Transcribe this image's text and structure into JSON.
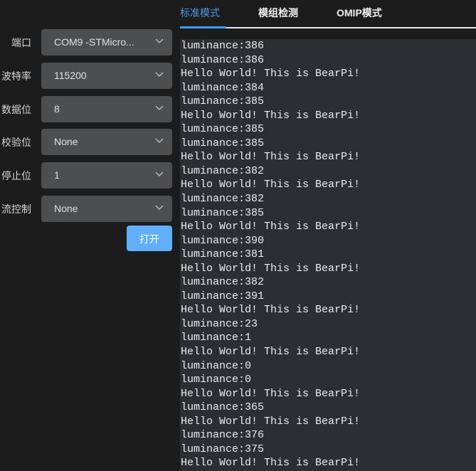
{
  "settings": {
    "fields": [
      {
        "label": "端口",
        "value": "COM9 -STMicro..."
      },
      {
        "label": "波特率",
        "value": "115200"
      },
      {
        "label": "数据位",
        "value": "8"
      },
      {
        "label": "校验位",
        "value": "None"
      },
      {
        "label": "停止位",
        "value": "1"
      },
      {
        "label": "流控制",
        "value": "None"
      }
    ],
    "open_button": "打开"
  },
  "tabs": [
    {
      "label": "标准模式",
      "active": true
    },
    {
      "label": "模组检测",
      "active": false
    },
    {
      "label": "OMIP模式",
      "active": false
    }
  ],
  "colors": {
    "accent": "#409eff",
    "button": "#61aefb",
    "console_bg": "#2b2f31"
  },
  "console": {
    "lines": [
      "luminance:386",
      "luminance:386",
      "Hello World! This is BearPi!",
      "luminance:384",
      "luminance:385",
      "Hello World! This is BearPi!",
      "luminance:385",
      "luminance:385",
      "Hello World! This is BearPi!",
      "luminance:382",
      "Hello World! This is BearPi!",
      "luminance:382",
      "luminance:385",
      "Hello World! This is BearPi!",
      "luminance:390",
      "luminance:381",
      "Hello World! This is BearPi!",
      "luminance:382",
      "luminance:391",
      "Hello World! This is BearPi!",
      "luminance:23",
      "luminance:1",
      "Hello World! This is BearPi!",
      "luminance:0",
      "luminance:0",
      "Hello World! This is BearPi!",
      "luminance:365",
      "Hello World! This is BearPi!",
      "luminance:376",
      "luminance:375",
      "Hello World! This is BearPi!"
    ]
  }
}
